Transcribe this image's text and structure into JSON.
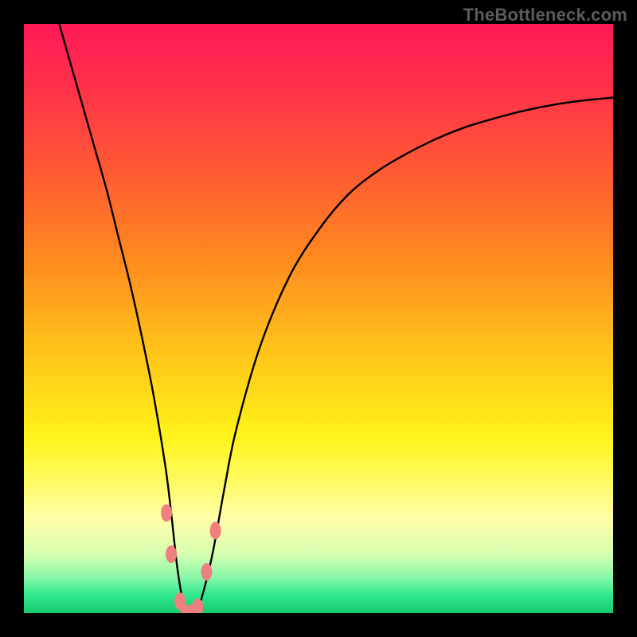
{
  "watermark": "TheBottleneck.com",
  "chart_data": {
    "type": "line",
    "title": "",
    "xlabel": "",
    "ylabel": "",
    "xlim": [
      0,
      100
    ],
    "ylim": [
      0,
      100
    ],
    "grid": false,
    "legend": false,
    "background_gradient": {
      "stops": [
        {
          "offset": 0.0,
          "color": "#ff1a57"
        },
        {
          "offset": 0.1,
          "color": "#ff2f4a"
        },
        {
          "offset": 0.25,
          "color": "#ff5a33"
        },
        {
          "offset": 0.4,
          "color": "#ff8a1f"
        },
        {
          "offset": 0.55,
          "color": "#ffc21a"
        },
        {
          "offset": 0.7,
          "color": "#fff31a"
        },
        {
          "offset": 0.78,
          "color": "#fffb66"
        },
        {
          "offset": 0.84,
          "color": "#fffea8"
        },
        {
          "offset": 0.9,
          "color": "#d6ffb0"
        },
        {
          "offset": 0.94,
          "color": "#86f7a8"
        },
        {
          "offset": 0.97,
          "color": "#2fe78d"
        },
        {
          "offset": 1.0,
          "color": "#19c96f"
        }
      ]
    },
    "series": [
      {
        "name": "bottleneck-curve",
        "x": [
          6,
          8,
          10,
          12,
          14,
          16,
          18,
          20,
          22,
          24,
          25,
          26,
          27,
          28,
          29,
          30,
          32,
          34,
          36,
          40,
          45,
          50,
          55,
          60,
          65,
          70,
          75,
          80,
          85,
          90,
          95,
          100
        ],
        "y": [
          100,
          93,
          86,
          79,
          72,
          64,
          56,
          47,
          37,
          25,
          17,
          8,
          2,
          0,
          0,
          2,
          10,
          21,
          31,
          45,
          57,
          65,
          71,
          75,
          78,
          80.5,
          82.5,
          84,
          85.3,
          86.3,
          87,
          87.5
        ]
      }
    ],
    "markers": [
      {
        "x": 24.2,
        "y": 17,
        "color": "#f08080"
      },
      {
        "x": 25.0,
        "y": 10,
        "color": "#f08080"
      },
      {
        "x": 26.5,
        "y": 2,
        "color": "#f08080"
      },
      {
        "x": 27.5,
        "y": 0,
        "color": "#f08080"
      },
      {
        "x": 28.5,
        "y": 0,
        "color": "#f08080"
      },
      {
        "x": 29.5,
        "y": 1,
        "color": "#f08080"
      },
      {
        "x": 31.0,
        "y": 7,
        "color": "#f08080"
      },
      {
        "x": 32.5,
        "y": 14,
        "color": "#f08080"
      }
    ]
  }
}
